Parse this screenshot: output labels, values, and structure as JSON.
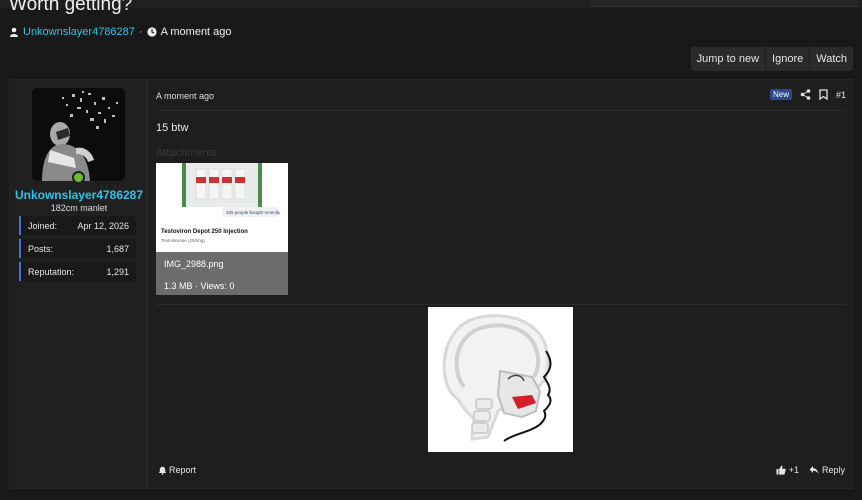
{
  "thread": {
    "title": "Worth getting?",
    "author": "Unkownslayer4786287",
    "separator": "·",
    "time": "A moment ago"
  },
  "actions": {
    "jump": "Jump to new",
    "ignore": "Ignore",
    "watch": "Watch"
  },
  "user": {
    "name": "Unkownslayer4786287",
    "title": "182cm manlet",
    "stats": [
      {
        "label": "Joined:",
        "value": "Apr 12, 2026"
      },
      {
        "label": "Posts:",
        "value": "1,687"
      },
      {
        "label": "Reputation:",
        "value": "1,291"
      }
    ]
  },
  "post": {
    "date": "A moment ago",
    "badge": "New",
    "number": "#1",
    "message": "15 btw",
    "attachments_label": "Attachments",
    "attachment": {
      "filename": "IMG_2988.png",
      "meta": "1.3 MB · Views: 0",
      "thumb_text": {
        "title": "Testoviron Depot 250 Injection",
        "sub": "Testosterone (250mg)",
        "chip": "326 people bought recently"
      }
    },
    "report": "Report",
    "reactions": "+1",
    "reply": "Reply"
  },
  "colors": {
    "link": "#2ec3e6",
    "online": "#6cbf2f",
    "stat_border": "#4e6fd8",
    "badge": "#2b4a8f"
  },
  "icons": [
    "user-icon",
    "clock-icon",
    "share-icon",
    "bookmark-icon",
    "bell-icon",
    "thumbs-up-icon",
    "reply-icon"
  ]
}
